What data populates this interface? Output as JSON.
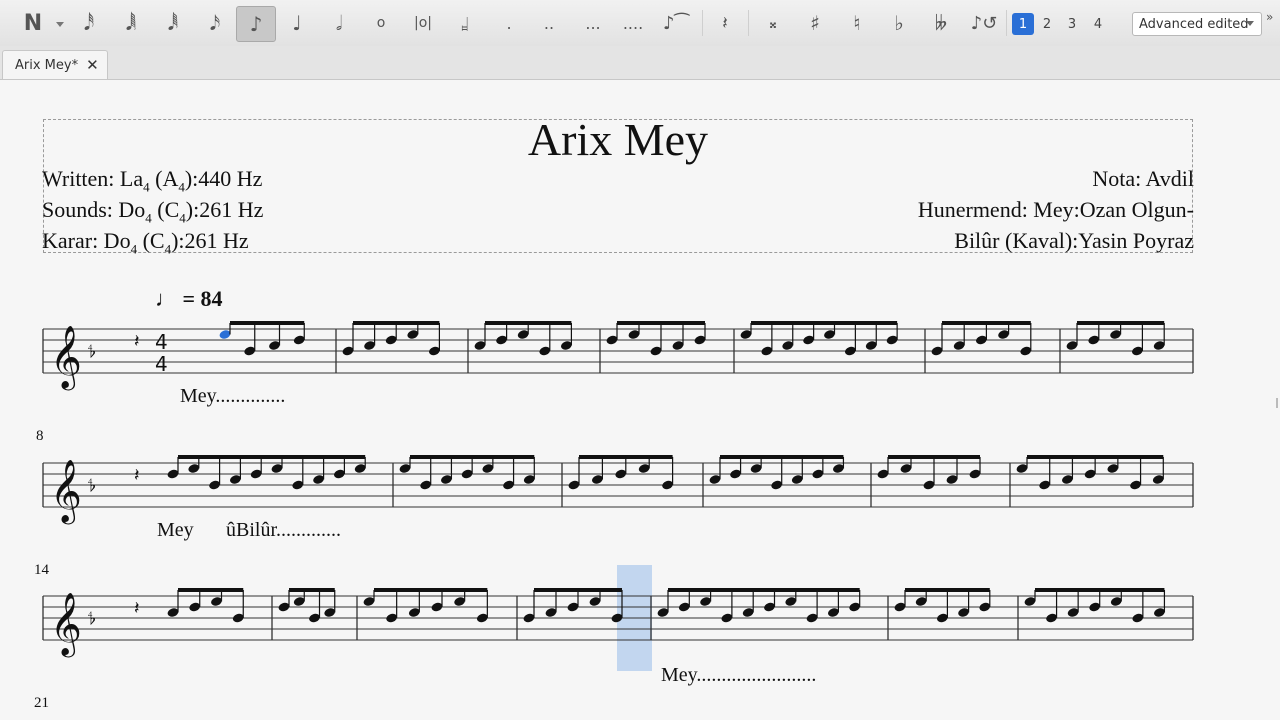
{
  "toolbar": {
    "tools": [
      {
        "name": "note-input-icon",
        "glyph": "𝅘𝅥𝅮"
      },
      {
        "name": "duration-1024-icon",
        "glyph": "𝅘𝅥𝅲"
      },
      {
        "name": "duration-64-icon",
        "glyph": "𝅘𝅥𝅲"
      },
      {
        "name": "duration-32-icon",
        "glyph": "𝅘𝅥𝅱"
      },
      {
        "name": "duration-16-icon",
        "glyph": "𝅘𝅥𝅯"
      },
      {
        "name": "duration-eighth-icon",
        "glyph": "♪"
      },
      {
        "name": "duration-quarter-icon",
        "glyph": "♩"
      },
      {
        "name": "duration-half-icon",
        "glyph": "𝅗𝅥"
      },
      {
        "name": "duration-whole-icon",
        "glyph": "𝅝"
      },
      {
        "name": "duration-breve-icon",
        "glyph": "𝅜"
      },
      {
        "name": "duration-longa-icon",
        "glyph": "𝆷"
      }
    ],
    "voices": [
      "1",
      "2",
      "3",
      "4"
    ],
    "workspace": "Advanced edited"
  },
  "tab": {
    "label": "Arix Mey*"
  },
  "score": {
    "title": "Arix Mey",
    "left_lines": [
      {
        "pre": "Written: La",
        "sub1": "4",
        "mid": " (A",
        "sub2": "4",
        "post": "):440 Hz"
      },
      {
        "pre": "Sounds: Do",
        "sub1": "4",
        "mid": " (C",
        "sub2": "4",
        "post": "):261 Hz"
      },
      {
        "pre": "Karar: Do",
        "sub1": "4",
        "mid": " (C",
        "sub2": "4",
        "post": "):261 Hz"
      }
    ],
    "right_lines": [
      "Nota: Avdil",
      "Hunermend: Mey:Ozan Olgun-",
      "Bilûr (Kaval):Yasin Poyraz"
    ],
    "tempo": "♩ = 84",
    "measure_numbers": [
      "8",
      "14",
      "21"
    ],
    "lyrics": [
      "Mey..............",
      "Mey",
      "ûBilûr.............",
      "Mey........................"
    ]
  }
}
